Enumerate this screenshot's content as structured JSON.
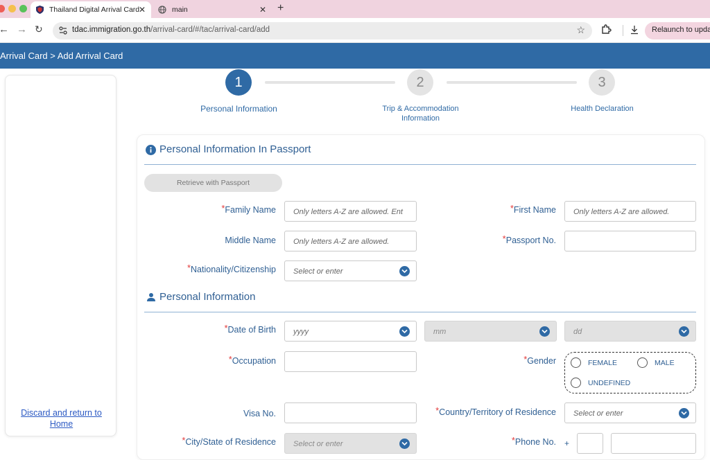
{
  "browser": {
    "tabs": [
      {
        "title": "Thailand Digital Arrival Card"
      },
      {
        "title": "main"
      }
    ],
    "url_host": "tdac.immigration.go.th",
    "url_path": "/arrival-card/#/tac/arrival-card/add",
    "relaunch_label": "Relaunch to update"
  },
  "header": {
    "breadcrumb": "Arrival Card > Add Arrival Card"
  },
  "sidebar": {
    "discard_line1": "Discard and return to",
    "discard_line2": "Home"
  },
  "stepper": [
    {
      "number": "1",
      "label": "Personal Information",
      "state": "active"
    },
    {
      "number": "2",
      "label_line1": "Trip & Accommodation",
      "label_line2": "Information",
      "state": "todo"
    },
    {
      "number": "3",
      "label": "Health Declaration",
      "state": "todo"
    }
  ],
  "passport_section": {
    "title": "Personal Information In Passport",
    "retrieve_label": "Retrieve with Passport",
    "family_name_label": "Family Name",
    "family_name_placeholder": "Only letters A-Z are allowed. Ent",
    "first_name_label": "First Name",
    "first_name_placeholder": "Only letters A-Z are allowed.",
    "middle_name_label": "Middle Name",
    "middle_name_placeholder": "Only letters A-Z are allowed.",
    "passport_no_label": "Passport No.",
    "passport_no_value": "",
    "nationality_label": "Nationality/Citizenship",
    "nationality_placeholder": "Select or enter"
  },
  "personal_section": {
    "title": "Personal Information",
    "dob_label": "Date of Birth",
    "dob_year_placeholder": "yyyy",
    "dob_month_placeholder": "mm",
    "dob_day_placeholder": "dd",
    "occupation_label": "Occupation",
    "occupation_value": "",
    "gender_label": "Gender",
    "gender_options": [
      "FEMALE",
      "MALE",
      "UNDEFINED"
    ],
    "visa_label": "Visa No.",
    "visa_value": "",
    "country_label": "Country/Territory of Residence",
    "country_placeholder": "Select or enter",
    "city_label": "City/State of Residence",
    "city_placeholder": "Select or enter",
    "phone_label": "Phone No.",
    "phone_prefix": "+"
  },
  "colors": {
    "brand": "#2f6aa5",
    "required": "#e23a3a",
    "label": "#2f5f93"
  }
}
